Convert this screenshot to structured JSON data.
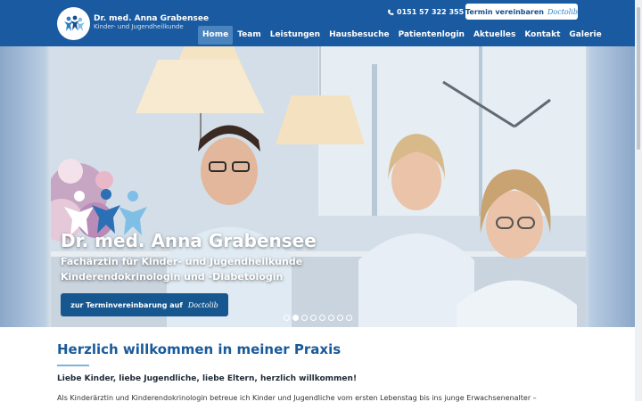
{
  "brand": {
    "name": "Dr. med. Anna Grabensee",
    "subtitle": "Kinder- und Jugendheilkunde"
  },
  "header": {
    "phone": "0151 57 322 355",
    "appointment_label": "Termin vereinbaren",
    "doctolib": "Doctolib"
  },
  "nav": {
    "items": [
      "Home",
      "Team",
      "Leistungen",
      "Hausbesuche",
      "Patientenlogin",
      "Aktuelles",
      "Kontakt",
      "Galerie"
    ],
    "active": "Home"
  },
  "hero": {
    "title": "Dr. med. Anna Grabensee",
    "line1": "Fachärztin für Kinder- und Jugendheilkunde",
    "line2": "Kinderendokrinologin und -Diabetologin",
    "cta_label": "zur Terminvereinbarung auf",
    "cta_brand": "Doctolib",
    "slides_total": 8,
    "slide_active": 2
  },
  "content": {
    "heading": "Herzlich willkommen in meiner Praxis",
    "intro": "Liebe Kinder, liebe Jugendliche, liebe Eltern, herzlich willkommen!",
    "body": "Als Kinderärztin und Kinderendokrinologin betreue ich Kinder und Jugendliche vom ersten Lebenstag bis ins junge Erwachsenenalter –"
  },
  "colors": {
    "primary": "#1a5aa0",
    "accent": "#4a84be",
    "heading": "#1a5a9a"
  }
}
